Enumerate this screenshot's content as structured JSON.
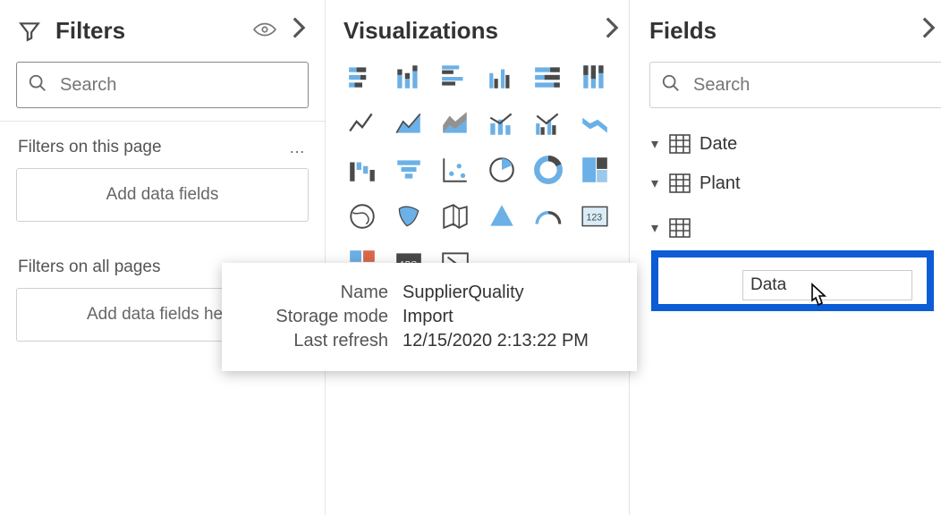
{
  "filters": {
    "title": "Filters",
    "search_placeholder": "Search",
    "section_page": "Filters on this page",
    "section_all": "Filters on all pages",
    "drop_text_1": "Add data fields",
    "drop_text_2": "Add data fields here"
  },
  "viz": {
    "title": "Visualizations"
  },
  "fields": {
    "title": "Fields",
    "search_placeholder": "Search",
    "items": [
      {
        "label": "Date"
      },
      {
        "label": "Plant"
      }
    ],
    "rename_value": "Data"
  },
  "tooltip": {
    "name_label": "Name",
    "name_value": "SupplierQuality",
    "storage_label": "Storage mode",
    "storage_value": "Import",
    "refresh_label": "Last refresh",
    "refresh_value": "12/15/2020 2:13:22 PM"
  }
}
